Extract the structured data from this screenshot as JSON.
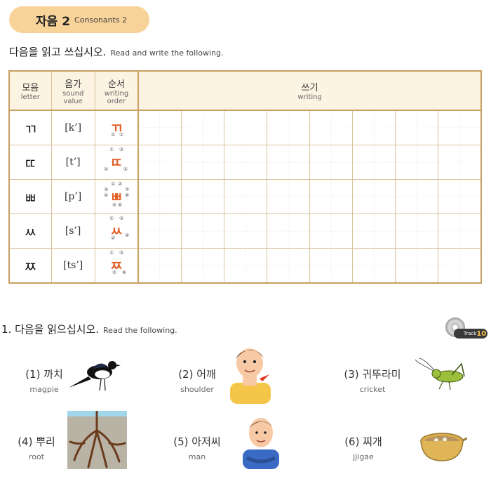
{
  "header": {
    "title_ko": "자음 2",
    "title_en": "Consonants 2",
    "instruction_ko": "다음을 읽고 쓰십시오.",
    "instruction_en": "Read and write the following."
  },
  "table": {
    "headers": {
      "letter_ko": "모음",
      "letter_en": "letter",
      "sound_ko": "음가",
      "sound_en1": "sound",
      "sound_en2": "value",
      "order_ko": "순서",
      "order_en1": "writing",
      "order_en2": "order",
      "writing_ko": "쓰기",
      "writing_en": "writing"
    },
    "rows": [
      {
        "letter": "ㄲ",
        "sound": "[k’]",
        "nums": [
          "①",
          "②"
        ]
      },
      {
        "letter": "ㄸ",
        "sound": "[t’]",
        "nums": [
          "①",
          "③",
          "②",
          "④"
        ]
      },
      {
        "letter": "ㅃ",
        "sound": "[p’]",
        "nums": [
          "①",
          "②",
          "③",
          "④",
          "⑦",
          "⑧",
          "⑤",
          "⑥"
        ]
      },
      {
        "letter": "ㅆ",
        "sound": "[s’]",
        "nums": [
          "①",
          "③",
          "②",
          "④"
        ]
      },
      {
        "letter": "ㅉ",
        "sound": "[ts’]",
        "nums": [
          "①",
          "③",
          "②",
          "④"
        ]
      }
    ]
  },
  "section1": {
    "instruction_ko": "1. 다음을 읽으십시오.",
    "instruction_en": "Read the following.",
    "track_label": "Track",
    "track_number": "10",
    "items": [
      {
        "ko": "(1) 까치",
        "en": "magpie"
      },
      {
        "ko": "(2) 어깨",
        "en": "shoulder"
      },
      {
        "ko": "(3) 귀뚜라미",
        "en": "cricket"
      },
      {
        "ko": "(4) 뿌리",
        "en": "root"
      },
      {
        "ko": "(5) 아저씨",
        "en": "man"
      },
      {
        "ko": "(6) 찌개",
        "en": "jjigae"
      }
    ]
  },
  "colors": {
    "accent": "#f7d39a",
    "border": "#c8a062",
    "stroke": "#e2622a"
  }
}
